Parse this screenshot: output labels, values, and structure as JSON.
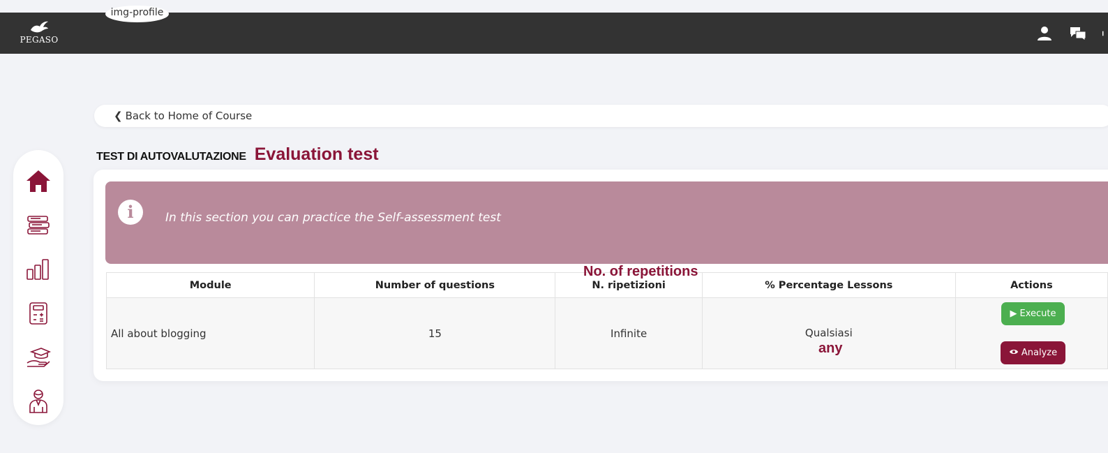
{
  "header": {
    "logo_text": "PEGASO",
    "img_alt_text": "img-profile",
    "icons": [
      "user-icon",
      "chat-icon",
      "menu-icon"
    ]
  },
  "sidebar": {
    "items": [
      {
        "icon": "home-icon"
      },
      {
        "icon": "books-icon"
      },
      {
        "icon": "bar-chart-icon"
      },
      {
        "icon": "calculator-icon"
      },
      {
        "icon": "graduation-hand-icon"
      },
      {
        "icon": "teacher-icon"
      }
    ]
  },
  "breadcrumb": {
    "back_label": "Back to Home of Course"
  },
  "page": {
    "title": "TEST DI AUTOVALUTAZIONE",
    "title_translation": "Evaluation test"
  },
  "alert": {
    "text": "In this section you can practice the Self-assessment test",
    "icon": "info-icon"
  },
  "table": {
    "headers": [
      "Module",
      "Number of questions",
      "N. ripetizioni",
      "% Percentage Lessons",
      "Actions"
    ],
    "header_translation_repetitions": "No. of repetitions",
    "rows": [
      {
        "module": "All about blogging",
        "questions": "15",
        "repetitions": "Infinite",
        "percentage": "Qualsiasi",
        "percentage_translation": "any",
        "actions": {
          "execute": "Execute",
          "analyze": "Analyze"
        }
      }
    ]
  },
  "colors": {
    "accent": "#8a1538",
    "alert_bg": "#b98a9b",
    "execute_green": "#4caf50",
    "topbar": "#333333"
  }
}
